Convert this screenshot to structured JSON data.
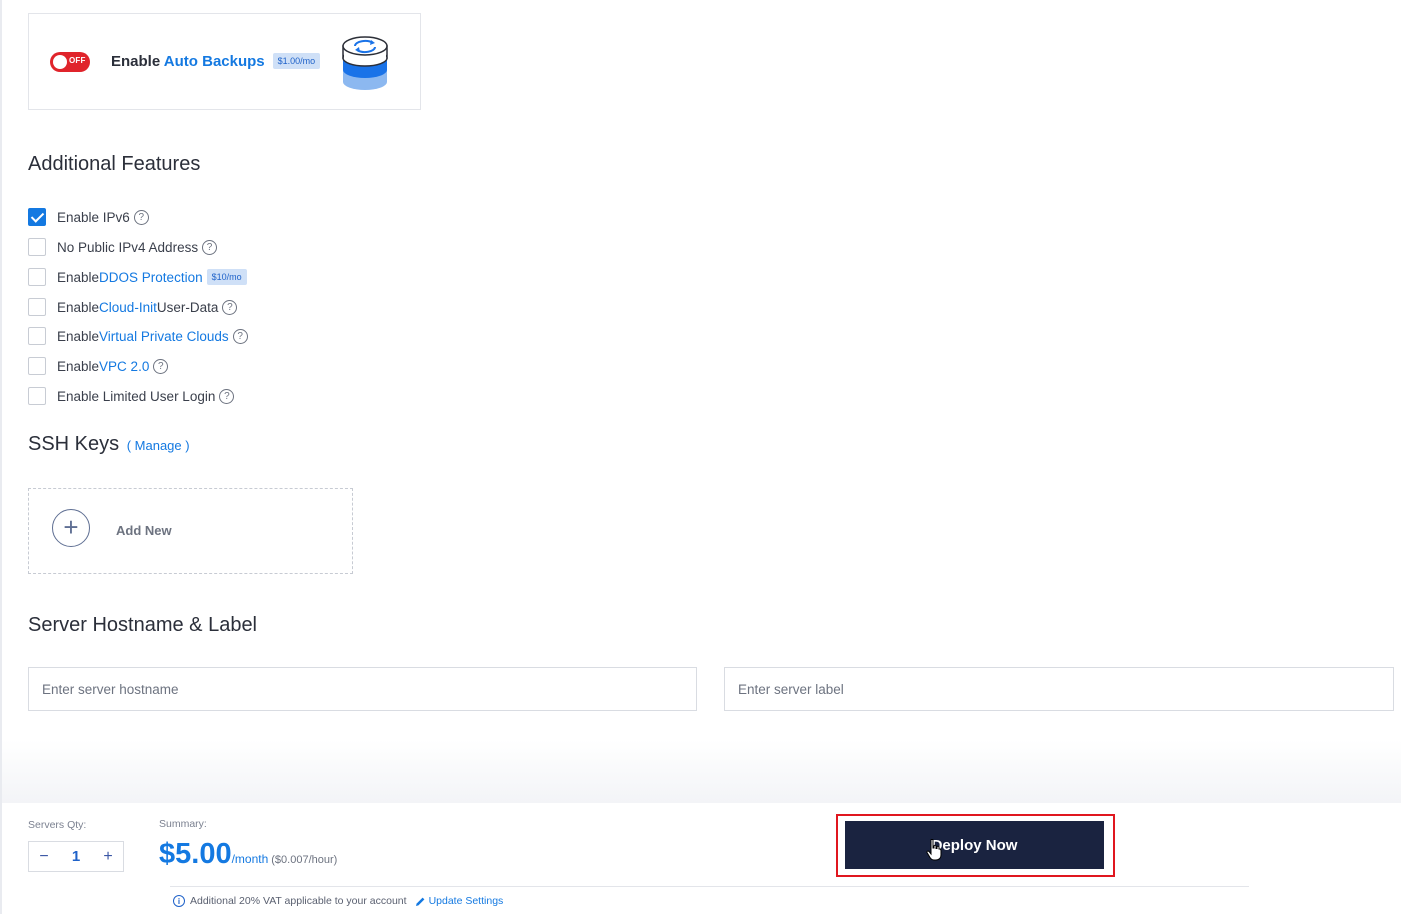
{
  "auto_backups": {
    "toggle_state": "OFF",
    "label_prefix": "Enable ",
    "label_highlight": "Auto Backups",
    "price": "$1.00/mo",
    "icon": "backup-sync-icon",
    "toggle_color": "#e0242b"
  },
  "additional_features": {
    "title": "Additional Features",
    "items": [
      {
        "prefix": "Enable IPv6",
        "highlight": "",
        "suffix": "",
        "checked": true,
        "help": true,
        "price": ""
      },
      {
        "prefix": "No Public IPv4 Address",
        "highlight": "",
        "suffix": "",
        "checked": false,
        "help": true,
        "price": ""
      },
      {
        "prefix": "Enable ",
        "highlight": "DDOS Protection",
        "suffix": "",
        "checked": false,
        "help": false,
        "price": "$10/mo"
      },
      {
        "prefix": "Enable ",
        "highlight": "Cloud-Init",
        "suffix": " User-Data",
        "checked": false,
        "help": true,
        "price": ""
      },
      {
        "prefix": "Enable ",
        "highlight": "Virtual Private Clouds",
        "suffix": "",
        "checked": false,
        "help": true,
        "price": ""
      },
      {
        "prefix": "Enable ",
        "highlight": "VPC 2.0",
        "suffix": "",
        "checked": false,
        "help": true,
        "price": ""
      },
      {
        "prefix": "Enable Limited User Login",
        "highlight": "",
        "suffix": "",
        "checked": false,
        "help": true,
        "price": ""
      }
    ]
  },
  "ssh_keys": {
    "title": "SSH Keys",
    "manage_link": "( Manage )",
    "add_new_label": "Add New",
    "add_icon": "plus-circle-icon"
  },
  "hostname": {
    "title": "Server Hostname & Label",
    "hostname_placeholder": "Enter server hostname",
    "hostname_value": "",
    "label_placeholder": "Enter server label",
    "label_value": ""
  },
  "footer": {
    "qty_label": "Servers Qty:",
    "qty_value": "1",
    "minus": "−",
    "plus": "+",
    "summary_label": "Summary:",
    "price": "$5.00",
    "per_month": "/month",
    "per_hour": "($0.007/hour)",
    "deploy_label": "Deploy Now",
    "vat_note": "Additional 20% VAT applicable to your account",
    "update_link": "Update Settings",
    "accent_color": "#1479e1",
    "deploy_color": "#1a2340",
    "highlight_border_color": "#e0171f"
  }
}
